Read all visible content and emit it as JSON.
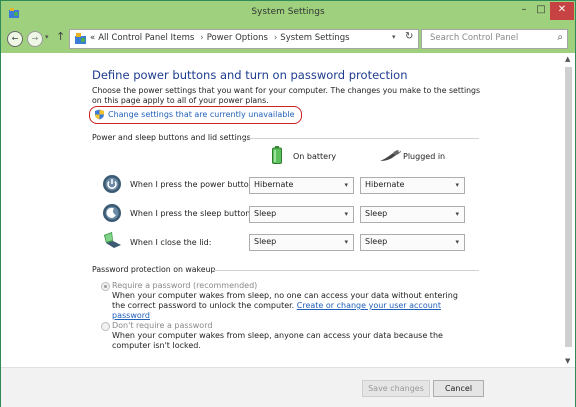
{
  "window": {
    "title": "System Settings"
  },
  "titlebar": {
    "minimize": "–",
    "maximize": "□",
    "close": "✕"
  },
  "nav": {
    "breadcrumb": [
      "«",
      "All Control Panel Items",
      "Power Options",
      "System Settings"
    ],
    "search_placeholder": "Search Control Panel"
  },
  "main": {
    "heading": "Define power buttons and turn on password protection",
    "description": "Choose the power settings that you want for your computer. The changes you make to the settings on this page apply to all of your power plans.",
    "change_link": "Change settings that are currently unavailable",
    "section_power": "Power and sleep buttons and lid settings",
    "col_battery": "On battery",
    "col_plugged": "Plugged in",
    "rows": [
      {
        "label": "When I press the power button:",
        "battery": "Hibernate",
        "plugged": "Hibernate"
      },
      {
        "label": "When I press the sleep button:",
        "battery": "Sleep",
        "plugged": "Sleep"
      },
      {
        "label": "When I close the lid:",
        "battery": "Sleep",
        "plugged": "Sleep"
      }
    ],
    "section_password": "Password protection on wakeup",
    "require_label": "Require a password (recommended)",
    "require_desc": "When your computer wakes from sleep, no one can access your data without entering the correct password to unlock the computer.",
    "require_link": "Create or change your user account password",
    "norequire_label": "Don't require a password",
    "norequire_desc": "When your computer wakes from sleep, anyone can access your data because the computer isn't locked."
  },
  "footer": {
    "save": "Save changes",
    "cancel": "Cancel"
  },
  "colors": {
    "accent": "#9ed07e",
    "heading": "#1e3d8f",
    "link": "#1f5fb8",
    "highlight": "#cc2222"
  }
}
